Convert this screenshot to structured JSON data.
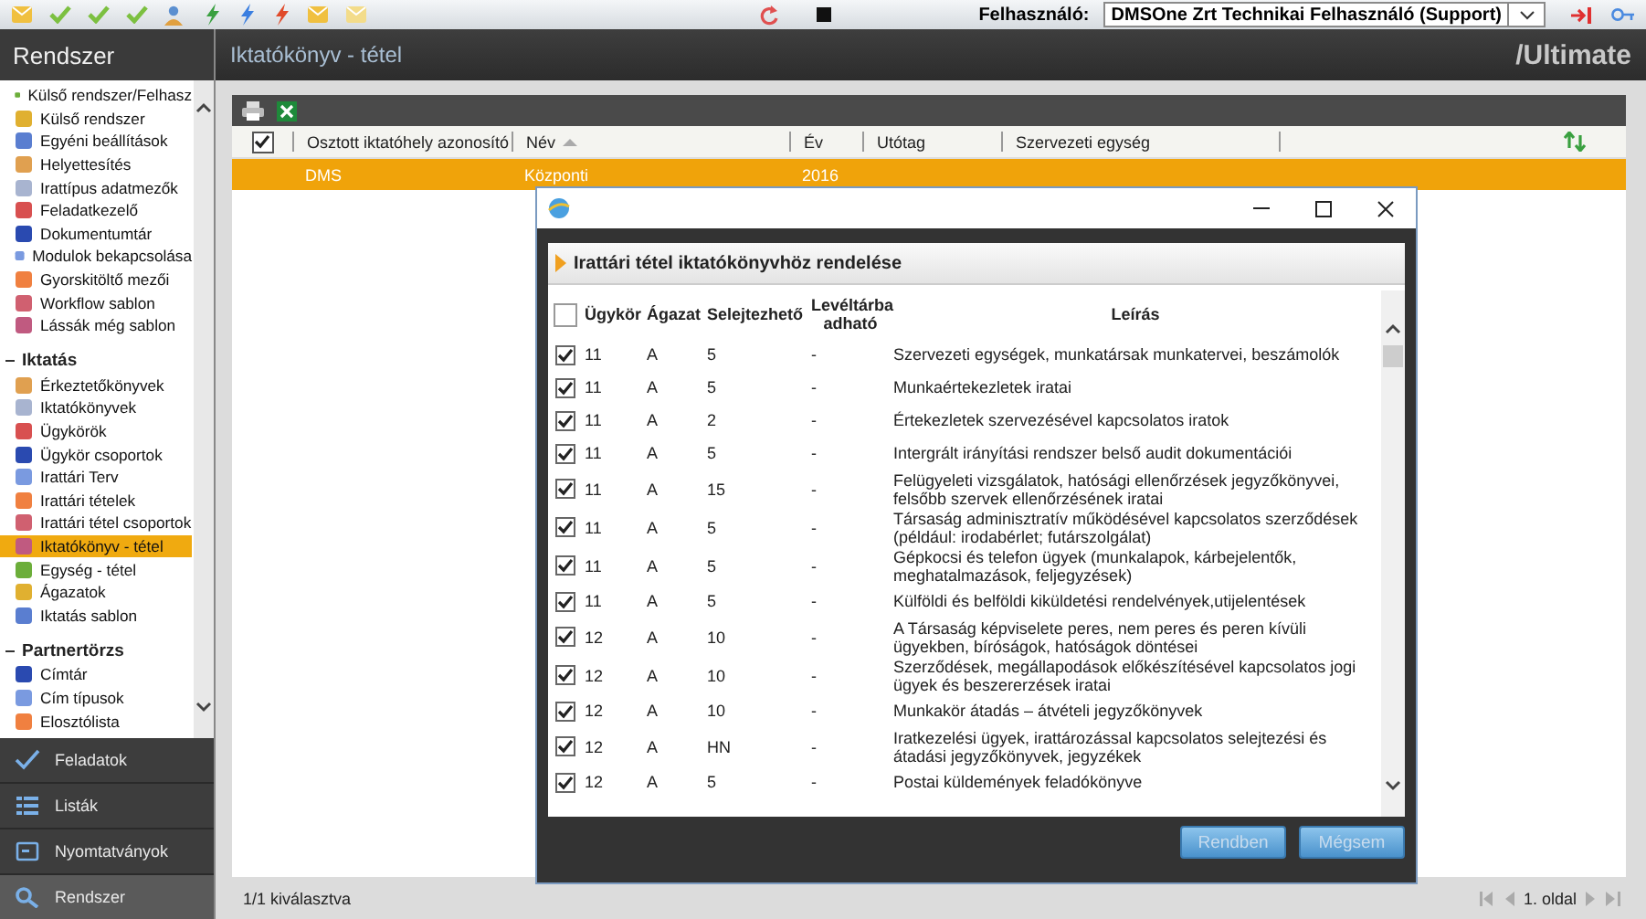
{
  "toolbar": {
    "user_label": "Felhasználó:",
    "user_value": "DMSOne Zrt Technikai Felhasználó (Support)"
  },
  "sidebar": {
    "title": "Rendszer",
    "groups": [
      {
        "items": [
          {
            "label": "Külső rendszer/Felhasz",
            "selected": false
          },
          {
            "label": "Külső rendszer",
            "selected": false
          },
          {
            "label": "Egyéni beállítások",
            "selected": false
          },
          {
            "label": "Helyettesítés",
            "selected": false
          },
          {
            "label": "Irattípus adatmezők",
            "selected": false
          },
          {
            "label": "Feladatkezelő",
            "selected": false
          },
          {
            "label": "Dokumentumtár",
            "selected": false
          },
          {
            "label": "Modulok bekapcsolása",
            "selected": false
          },
          {
            "label": "Gyorskitöltő mezői",
            "selected": false
          },
          {
            "label": "Workflow sablon",
            "selected": false
          },
          {
            "label": "Lássák még sablon",
            "selected": false
          }
        ]
      },
      {
        "title": "Iktatás",
        "expanded": true,
        "items": [
          {
            "label": "Érkeztetőkönyvek",
            "selected": false
          },
          {
            "label": "Iktatókönyvek",
            "selected": false
          },
          {
            "label": "Ügykörök",
            "selected": false
          },
          {
            "label": "Ügykör csoportok",
            "selected": false
          },
          {
            "label": "Irattári Terv",
            "selected": false
          },
          {
            "label": "Irattári tételek",
            "selected": false
          },
          {
            "label": "Irattári tétel csoportok",
            "selected": false
          },
          {
            "label": "Iktatókönyv - tétel",
            "selected": true
          },
          {
            "label": "Egység - tétel",
            "selected": false
          },
          {
            "label": "Ágazatok",
            "selected": false
          },
          {
            "label": "Iktatás sablon",
            "selected": false
          }
        ]
      },
      {
        "title": "Partnertörzs",
        "expanded": true,
        "items": [
          {
            "label": "Címtár",
            "selected": false
          },
          {
            "label": "Cím típusok",
            "selected": false
          },
          {
            "label": "Elosztólista",
            "selected": false
          }
        ]
      }
    ],
    "nav": [
      {
        "label": "Feladatok",
        "selected": false
      },
      {
        "label": "Listák",
        "selected": false
      },
      {
        "label": "Nyomtatványok",
        "selected": false
      },
      {
        "label": "Rendszer",
        "selected": true
      }
    ]
  },
  "main": {
    "title": "Iktatókönyv - tétel",
    "logo": "/Ultimate",
    "grid": {
      "header_checked": true,
      "columns": [
        {
          "label": "Osztott iktatóhely azonosító",
          "sorted": false
        },
        {
          "label": "Név",
          "sorted": true
        },
        {
          "label": "Év",
          "sorted": false
        },
        {
          "label": "Utótag",
          "sorted": false
        },
        {
          "label": "Szervezeti egység",
          "sorted": false
        }
      ],
      "rows": [
        {
          "selected": true,
          "cells": [
            "DMS",
            "Központi",
            "2016"
          ]
        }
      ]
    },
    "status": "1/1 kiválasztva",
    "pager": "1. oldal"
  },
  "dialog": {
    "panel_title": "Irattári tétel iktatókönyvhöz rendelése",
    "header_checked": false,
    "columns": [
      "Ügykör",
      "Ágazat",
      "Selejtezhető",
      "Levéltárba adható",
      "Leírás"
    ],
    "rows": [
      {
        "checked": true,
        "cells": [
          "11",
          "A",
          "5",
          "-",
          "Szervezeti egységek, munkatársak munkatervei, beszámolók"
        ]
      },
      {
        "checked": true,
        "cells": [
          "11",
          "A",
          "5",
          "-",
          "Munkaértekezletek iratai"
        ]
      },
      {
        "checked": true,
        "cells": [
          "11",
          "A",
          "2",
          "-",
          "Értekezletek szervezésével kapcsolatos iratok"
        ]
      },
      {
        "checked": true,
        "cells": [
          "11",
          "A",
          "5",
          "-",
          "Intergrált irányítási rendszer belső audit dokumentációi"
        ]
      },
      {
        "checked": true,
        "cells": [
          "11",
          "A",
          "15",
          "-",
          "Felügyeleti vizsgálatok, hatósági ellenőrzések jegyzőkönyvei, felsőbb szervek ellenőrzésének iratai"
        ]
      },
      {
        "checked": true,
        "cells": [
          "11",
          "A",
          "5",
          "-",
          "Társaság adminisztratív működésével kapcsolatos szerződések (például: irodabérlet; futárszolgálat)"
        ]
      },
      {
        "checked": true,
        "cells": [
          "11",
          "A",
          "5",
          "-",
          "Gépkocsi és telefon ügyek (munkalapok, kárbejelentők, meghatalmazások, feljegyzések)"
        ]
      },
      {
        "checked": true,
        "cells": [
          "11",
          "A",
          "5",
          "-",
          "Külföldi és belföldi kiküldetési rendelvények,utijelentések"
        ]
      },
      {
        "checked": true,
        "cells": [
          "12",
          "A",
          "10",
          "-",
          "A Társaság képviselete peres, nem peres és peren kívüli ügyekben, bíróságok, hatóságok döntései"
        ]
      },
      {
        "checked": true,
        "cells": [
          "12",
          "A",
          "10",
          "-",
          "Szerződések, megállapodások előkészítésével kapcsolatos jogi ügyek és beszererzések iratai"
        ]
      },
      {
        "checked": true,
        "cells": [
          "12",
          "A",
          "10",
          "-",
          "Munkakör átadás – átvételi jegyzőkönyvek"
        ]
      },
      {
        "checked": true,
        "cells": [
          "12",
          "A",
          "HN",
          "-",
          "Iratkezelési ügyek, irattározással kapcsolatos selejtezési és átadási jegyzőkönyvek, jegyzékek"
        ]
      },
      {
        "checked": true,
        "cells": [
          "12",
          "A",
          "5",
          "-",
          "Postai küldemények feladókönyve"
        ]
      }
    ],
    "buttons": [
      "Rendben",
      "Mégsem"
    ]
  }
}
